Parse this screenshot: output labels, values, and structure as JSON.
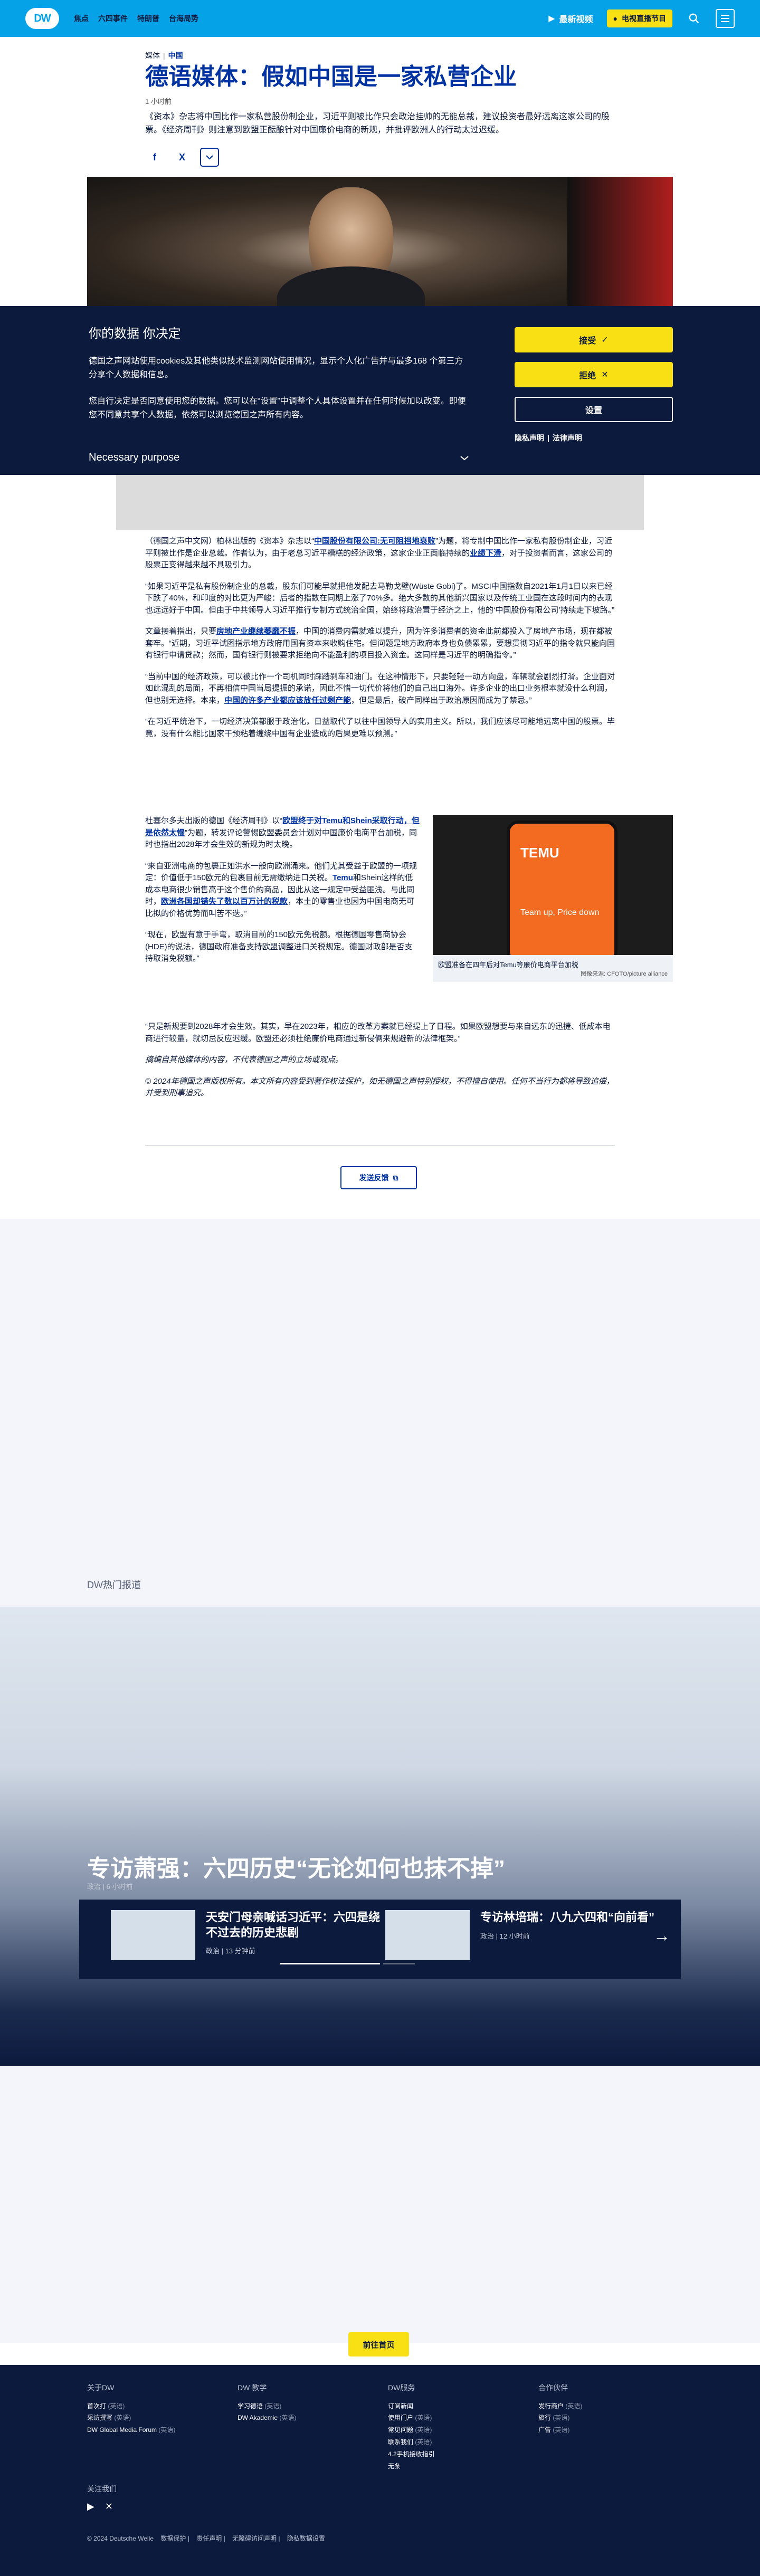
{
  "header": {
    "logo": "DW",
    "links": [
      "焦点",
      "六四事件",
      "特朗普",
      "台海局势"
    ],
    "latest_videos": "最新视频",
    "live_tv": "电视直播节目"
  },
  "article": {
    "kicker_prefix": "媒体",
    "kicker_category": "中国",
    "title": "德语媒体：假如中国是一家私营企业",
    "timestamp": "1 小时前",
    "lead": "《资本》杂志将中国比作一家私营股份制企业，习近平则被比作只会政治挂帅的无能总裁，建议投资者最好远离这家公司的股票。《经济周刊》则注意到欧盟正酝酿针对中国廉价电商的新规，并批评欧洲人的行动太过迟缓。",
    "share_facebook": "f",
    "share_x": "X"
  },
  "cookie": {
    "title": "你的数据 你决定",
    "p1": "德国之声网站使用cookies及其他类似技术监测网站使用情况，显示个人化广告并与最多168 个第三方分享个人数据和信息。",
    "p2": "您自行决定是否同意使用您的数据。您可以在“设置”中调整个人具体设置并在任何时候加以改变。即便您不同意共享个人数据，依然可以浏览德国之声所有内容。",
    "purpose": "Necessary purpose",
    "accept": "接受",
    "reject": "拒绝",
    "settings": "设置",
    "privacy": "隐私声明",
    "legal": "法律声明"
  },
  "body": {
    "p1a": "（德国之声中文网）柏林出版的《资本》杂志以“",
    "p1link": "中国股份有限公司:无可阻挡地衰败",
    "p1b": "”为题，将专制中国比作一家私有股份制企业，习近平则被比作是企业总裁。作者认为，由于老总习近平糟糕的经济政策，这家企业正面临持续的",
    "p1link2": "业绩下滑",
    "p1c": "，对于投资者而言，这家公司的股票正变得越来越不具吸引力。",
    "p2": "“如果习近平是私有股份制企业的总裁，股东们可能早就把他发配去马勒戈壁(Wüste Gobi)了。MSCI中国指数自2021年1月1日以来已经下跌了40%，和印度的对比更为严峻：后者的指数在同期上涨了70%多。绝大多数的其他新兴国家以及传统工业国在这段时间内的表现也远远好于中国。但由于中共领导人习近平推行专制方式统治全国，始终将政治置于经济之上，他的‘中国股份有限公司’持续走下坡路。”",
    "p3a": "文章接着指出，只要",
    "p3link": "房地产业继续萎靡不振",
    "p3b": "，中国的消费内需就难以提升，因为许多消费者的资金此前都投入了房地产市场，现在都被套牢。“近期，习近平试图指示地方政府用国有资本来收购住宅。但问题是地方政府本身也负债累累，要想贯彻习近平的指令就只能向国有银行申请贷款；然而，国有银行则被要求拒绝向不能盈利的项目投入资金。这同样是习近平的明确指令。”",
    "p4a": "“当前中国的经济政策，可以被比作一个司机同时踩踏刹车和油门。在这种情形下，只要轻轻一动方向盘，车辆就会剧烈打滑。企业面对如此混乱的局面，不再相信中国当局提振的承诺，因此不惜一切代价将他们的自己出口海外。许多企业的出口业务根本就没什么利润，但也别无选择。本来，",
    "p4link": "中国的许多产业都应该放任过剩产能",
    "p4b": "，但是最后，破产同样出于政治原因而成为了禁忌。”",
    "p5": "“在习近平统治下，一切经济决策都服于政治化，日益取代了以往中国领导人的实用主义。所以，我们应该尽可能地远离中国的股票。毕竟，没有什么能比国家干预粘着缠绕中国有企业造成的后果更难以预测。”",
    "p6a": "杜塞尔多夫出版的德国《经济周刊》以“",
    "p6link": "欧盟终于对Temu和Shein采取行动，但是依然太慢",
    "p6b": "”为题，转发评论警惕欧盟委员会计划对中国廉价电商平台加税，同时也指出2028年才会生效的新规为时太晚。",
    "p7a": "“来自亚洲电商的包裹正如洪水一般向欧洲涌来。他们尤其受益于欧盟的一项规定：价值低于150欧元的包裹目前无需缴纳进口关税。",
    "p7link1": "Temu",
    "p7b": "和Shein这样的低成本电商很少销售高于这个售价的商品，因此从这一规定中受益匪浅。与此同时，",
    "p7link2": "欧洲各国却错失了数以百万计的税款",
    "p7c": "，本土的零售业也因为中国电商无可比拟的价格优势而叫苦不迭。”",
    "p8": "“现在，欧盟有意于手弯，取消目前的150欧元免税额。根据德国零售商协会(HDE)的说法，德国政府准备支持欧盟调整进口关税规定。德国财政部是否支持取消免税额。”",
    "p9": "“只是新规要到2028年才会生效。其实，早在2023年，相应的改革方案就已经提上了日程。如果欧盟想要与来自远东的迅捷、低成本电商进行较量，就切忌反应迟缓。欧盟还必须杜绝廉价电商通过新侵俩来规避新的法律框架。”",
    "note": "摘编自其他媒体的内容，不代表德国之声的立场或观点。",
    "copyright": "© 2024年德国之声版权所有。本文所有内容受到著作权法保护，如无德国之声特别授权，不得擅自使用。任何不当行为都将导致追偿，并受到刑事追究。"
  },
  "figure": {
    "phone_brand": "TEMU",
    "phone_slogan": "Team up, Price down",
    "caption": "欧盟准备在四年后对Temu等廉价电商平台加税",
    "credit": "图像来源: CFOTO/picture alliance"
  },
  "feedback": "发送反馈",
  "trending": {
    "label": "DW热门报道",
    "hero_title": "专访萧强：六四历史“无论如何也抹不掉”",
    "hero_meta": "政治 | 6 小时前",
    "cards": [
      {
        "title": "天安门母亲喊话习近平：六四是绕不过去的历史悲剧",
        "meta": "政治 | 13 分钟前"
      },
      {
        "title": "专访林培瑞：八九六四和“向前看”",
        "meta": "政治 | 12 小时前"
      }
    ]
  },
  "home_button": "前往首页",
  "footer": {
    "about": {
      "title": "关于DW",
      "items": [
        [
          "首次打 ",
          "(英语)"
        ],
        [
          "采访撰写 ",
          "(英语)"
        ],
        [
          "DW Global Media Forum ",
          "(英语)"
        ]
      ]
    },
    "learn": {
      "title": "DW 教学",
      "items": [
        [
          "学习德语 ",
          "(英语)"
        ],
        [
          "DW Akademie ",
          "(英语)"
        ]
      ]
    },
    "service": {
      "title": "DW服务",
      "items": [
        [
          "订阅新闻",
          ""
        ],
        [
          "使用门户 ",
          "(英语)"
        ],
        [
          "常见问题 ",
          "(英语)"
        ],
        [
          "联系我们 ",
          "(英语)"
        ],
        [
          "4.2手机接收指引",
          ""
        ],
        [
          "无条",
          ""
        ]
      ]
    },
    "partners": {
      "title": "合作伙伴",
      "items": [
        [
          "发行商户 ",
          "(英语)"
        ],
        [
          "旅行 ",
          "(英语)"
        ],
        [
          "广告 ",
          "(英语)"
        ]
      ]
    },
    "follow": "关注我们",
    "bottom": [
      "© 2024 Deutsche Welle",
      "数据保护",
      "责任声明",
      "无障碍访问声明",
      "隐私数据设置"
    ]
  }
}
